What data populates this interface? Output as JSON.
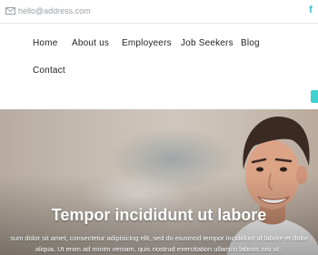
{
  "topbar": {
    "email": "hello@address.com",
    "email_icon": "envelope-icon",
    "social_icon": "facebook-icon",
    "social_glyph": "f"
  },
  "nav": {
    "items": [
      "Home",
      "About us",
      "Employeers",
      "Job Seekers",
      "Blog",
      "Contact"
    ]
  },
  "hero": {
    "title": "Tempor incididunt ut labore",
    "text_line1": "sum dolor sit amet, consectetur adipisicing elit, sed do eiusmod tempor incididunt ut labore et dolor",
    "text_line2": "aliqua. Ut enim ad minim veniam, quis nostrud exercitation ullamco laboris nisi ut ."
  },
  "colors": {
    "accent": "#3fd0d0",
    "text_dark": "#1f1f1f",
    "muted": "#9aa0a6"
  }
}
